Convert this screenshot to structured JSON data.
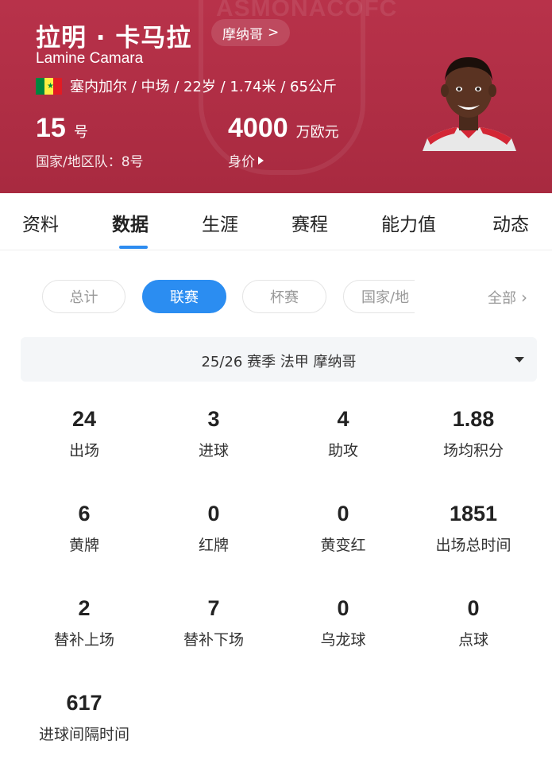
{
  "header": {
    "watermark": "ASMONACOFC",
    "name_cn": "拉明 · 卡马拉",
    "club_link": "摩纳哥",
    "name_en": "Lamine Camara",
    "info": "塞内加尔 / 中场 / 22岁 / 1.74米 / 65公斤",
    "flag_colors": [
      "#00853f",
      "#fdef42",
      "#e31b23"
    ],
    "shirt_number": "15",
    "shirt_number_unit": "号",
    "market_value": "4000",
    "market_value_unit": "万欧元",
    "national_team": "国家/地区队：8号",
    "market_value_label": "身价",
    "bg_color": "#b3304a"
  },
  "tabs": [
    "资料",
    "数据",
    "生涯",
    "赛程",
    "能力值",
    "动态"
  ],
  "active_tab": "数据",
  "filters": {
    "chips": [
      "总计",
      "联赛",
      "杯赛",
      "国家/地"
    ],
    "active": "联赛",
    "all_label": "全部"
  },
  "season_selector": "25/26 赛季  法甲  摩纳哥",
  "stats": [
    {
      "value": "24",
      "label": "出场"
    },
    {
      "value": "3",
      "label": "进球"
    },
    {
      "value": "4",
      "label": "助攻"
    },
    {
      "value": "1.88",
      "label": "场均积分"
    },
    {
      "value": "6",
      "label": "黄牌"
    },
    {
      "value": "0",
      "label": "红牌"
    },
    {
      "value": "0",
      "label": "黄变红"
    },
    {
      "value": "1851",
      "label": "出场总时间"
    },
    {
      "value": "2",
      "label": "替补上场"
    },
    {
      "value": "7",
      "label": "替补下场"
    },
    {
      "value": "0",
      "label": "乌龙球"
    },
    {
      "value": "0",
      "label": "点球"
    },
    {
      "value": "617",
      "label": "进球间隔时间"
    }
  ],
  "colors": {
    "accent": "#2b8df1"
  }
}
